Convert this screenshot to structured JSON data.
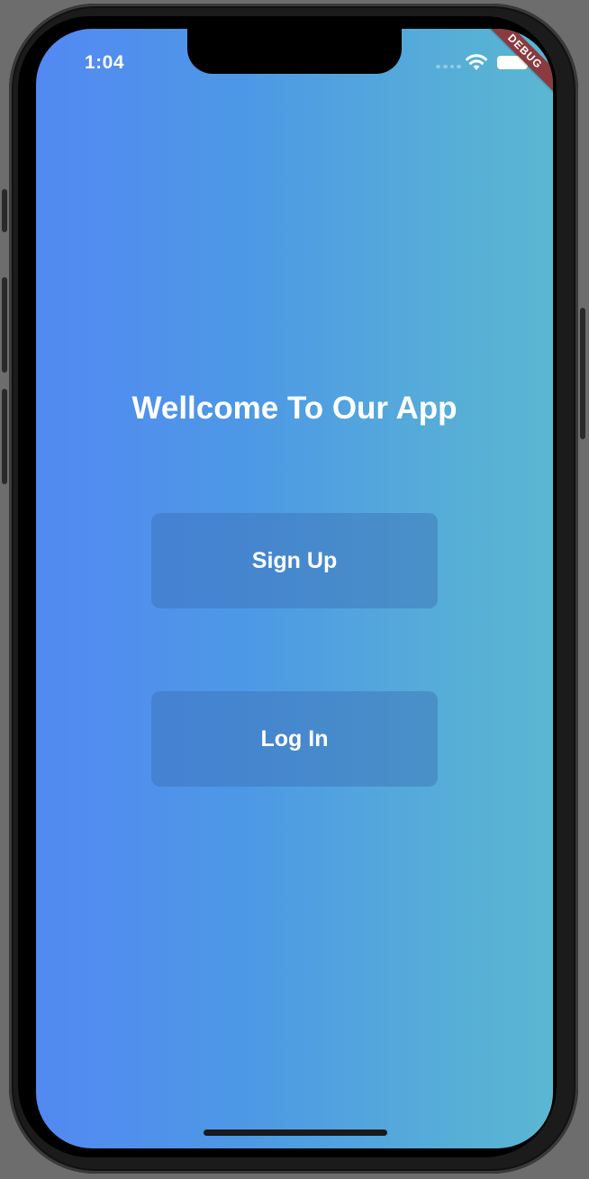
{
  "status_bar": {
    "time": "1:04"
  },
  "debug_banner": {
    "label": "DEBUG",
    "color": "#8b3a3f"
  },
  "welcome": {
    "title": "Wellcome To Our App"
  },
  "buttons": {
    "signup_label": "Sign Up",
    "login_label": "Log In"
  },
  "colors": {
    "gradient_start": "#5389f2",
    "gradient_end": "#5ab7d1",
    "button_overlay": "#3c6eb4"
  },
  "icons": [
    "wifi-icon",
    "battery-icon",
    "signal-icon"
  ]
}
